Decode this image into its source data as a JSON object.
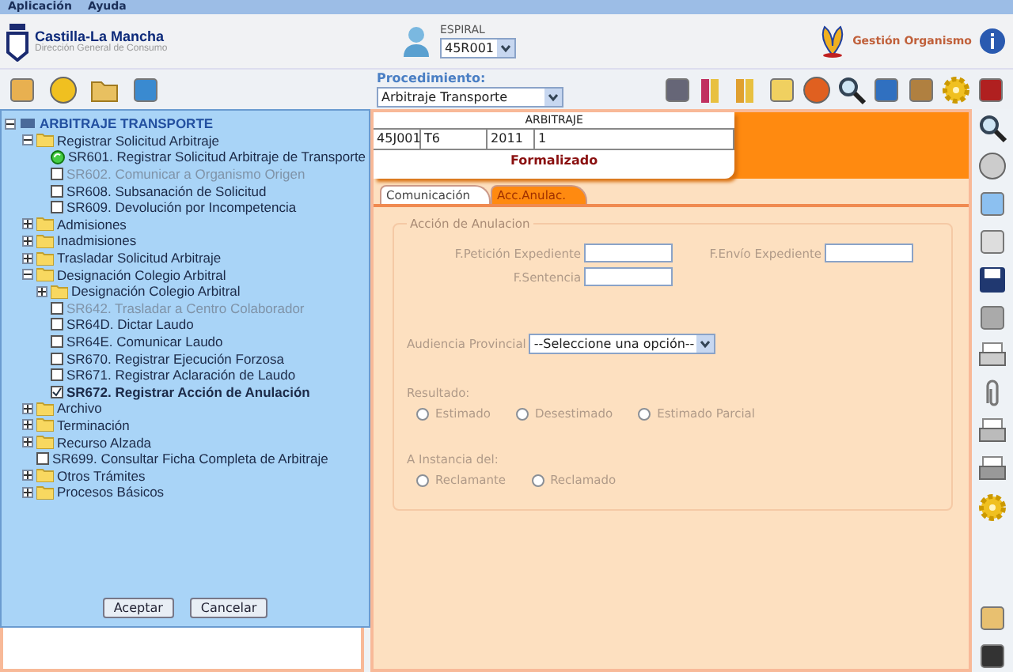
{
  "menu": [
    "Aplicación",
    "Ayuda"
  ],
  "header": {
    "org_name": "Castilla-La Mancha",
    "org_sub": "Dirección General de Consumo",
    "user_label": "ESPIRAL",
    "user_value": "45R001",
    "right_label": "Gestión Organismo"
  },
  "procedure": {
    "label": "Procedimiento:",
    "value": "Arbitraje Transporte"
  },
  "tree": {
    "label": "ARBITRAJE TRANSPORTE",
    "children": [
      {
        "kind": "folder",
        "label": "Registrar Solicitud Arbitraje",
        "expanded": true,
        "children": [
          {
            "kind": "current",
            "label": "SR601. Registrar Solicitud Arbitraje de Transporte",
            "disabled": false,
            "checked": false,
            "selected": false
          },
          {
            "kind": "task",
            "label": "SR602. Comunicar a Organismo Origen",
            "disabled": true,
            "checked": false,
            "selected": false
          },
          {
            "kind": "task",
            "label": "SR608. Subsanación de Solicitud",
            "disabled": false,
            "checked": false,
            "selected": false
          },
          {
            "kind": "task",
            "label": "SR609. Devolución por Incompetencia",
            "disabled": false,
            "checked": false,
            "selected": false
          }
        ]
      },
      {
        "kind": "folder",
        "label": "Admisiones",
        "expanded": false
      },
      {
        "kind": "folder",
        "label": "Inadmisiones",
        "expanded": false
      },
      {
        "kind": "folder",
        "label": "Trasladar Solicitud Arbitraje",
        "expanded": false
      },
      {
        "kind": "folder",
        "label": "Designación Colegio Arbitral",
        "expanded": true,
        "children": [
          {
            "kind": "folder",
            "label": "Designación Colegio Arbitral",
            "expanded": false
          },
          {
            "kind": "task",
            "label": "SR642. Trasladar a Centro Colaborador",
            "disabled": true,
            "checked": false,
            "selected": false
          },
          {
            "kind": "task",
            "label": "SR64D. Dictar Laudo",
            "disabled": false,
            "checked": false,
            "selected": false
          },
          {
            "kind": "task",
            "label": "SR64E. Comunicar Laudo",
            "disabled": false,
            "checked": false,
            "selected": false
          },
          {
            "kind": "task",
            "label": "SR670. Registrar Ejecución Forzosa",
            "disabled": false,
            "checked": false,
            "selected": false
          },
          {
            "kind": "task",
            "label": "SR671. Registrar Aclaración de Laudo",
            "disabled": false,
            "checked": false,
            "selected": false
          },
          {
            "kind": "task",
            "label": "SR672. Registrar Acción de Anulación",
            "disabled": false,
            "checked": true,
            "selected": true
          }
        ]
      },
      {
        "kind": "folder",
        "label": "Archivo",
        "expanded": false
      },
      {
        "kind": "folder",
        "label": "Terminación",
        "expanded": false
      },
      {
        "kind": "folder",
        "label": "Recurso Alzada",
        "expanded": false
      },
      {
        "kind": "task",
        "label": "SR699. Consultar Ficha Completa de Arbitraje",
        "disabled": false,
        "checked": false,
        "selected": false
      },
      {
        "kind": "folder",
        "label": "Otros Trámites",
        "expanded": false
      },
      {
        "kind": "folder",
        "label": "Procesos Básicos",
        "expanded": false
      }
    ]
  },
  "tree_buttons": [
    "Aceptar",
    "Cancelar"
  ],
  "record": {
    "title": "ARBITRAJE",
    "cells": [
      "45J001",
      "T6",
      "2011",
      "1"
    ],
    "status": "Formalizado"
  },
  "tabs": [
    {
      "label": "Comunicación",
      "selected": false
    },
    {
      "label": "Acc.Anulac.",
      "selected": true
    }
  ],
  "form": {
    "legend": "Acción de Anulacion",
    "dates": [
      {
        "label": "F.Petición Expediente"
      },
      {
        "label": "F.Envío Expediente"
      },
      {
        "label": "F.Sentencia"
      }
    ],
    "select": {
      "label": "Audiencia Provincial",
      "value": "--Seleccione una opción--"
    },
    "groups": [
      {
        "label": "Resultado:",
        "options": [
          {
            "label": "Estimado",
            "selected": false
          },
          {
            "label": "Desestimado",
            "selected": false
          },
          {
            "label": "Estimado Parcial",
            "selected": false
          }
        ]
      },
      {
        "label": "A Instancia del:",
        "options": [
          {
            "label": "Reclamante",
            "selected": false
          },
          {
            "label": "Reclamado",
            "selected": false
          }
        ]
      }
    ]
  }
}
